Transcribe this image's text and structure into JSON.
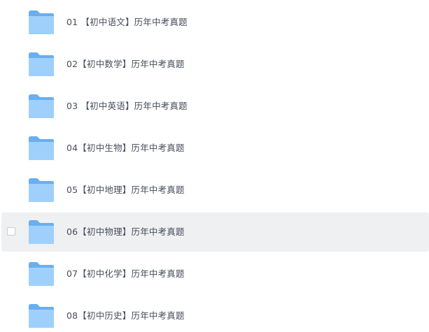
{
  "file_list": {
    "items": [
      {
        "name": "01 【初中语文】历年中考真题",
        "selected": false
      },
      {
        "name": "02【初中数学】历年中考真题",
        "selected": false
      },
      {
        "name": "03 【初中英语】历年中考真题",
        "selected": false
      },
      {
        "name": "04【初中生物】历年中考真题",
        "selected": false
      },
      {
        "name": "05【初中地理】历年中考真题",
        "selected": false
      },
      {
        "name": "06【初中物理】历年中考真题",
        "selected": true
      },
      {
        "name": "07【初中化学】历年中考真题",
        "selected": false
      },
      {
        "name": "08【初中历史】历年中考真题",
        "selected": false
      }
    ],
    "icon": "folder-icon",
    "colors": {
      "folder_back": "#6aaef0",
      "folder_front": "#9fd0fb",
      "selected_row": "#eff0f2",
      "text": "#454d5a"
    }
  }
}
